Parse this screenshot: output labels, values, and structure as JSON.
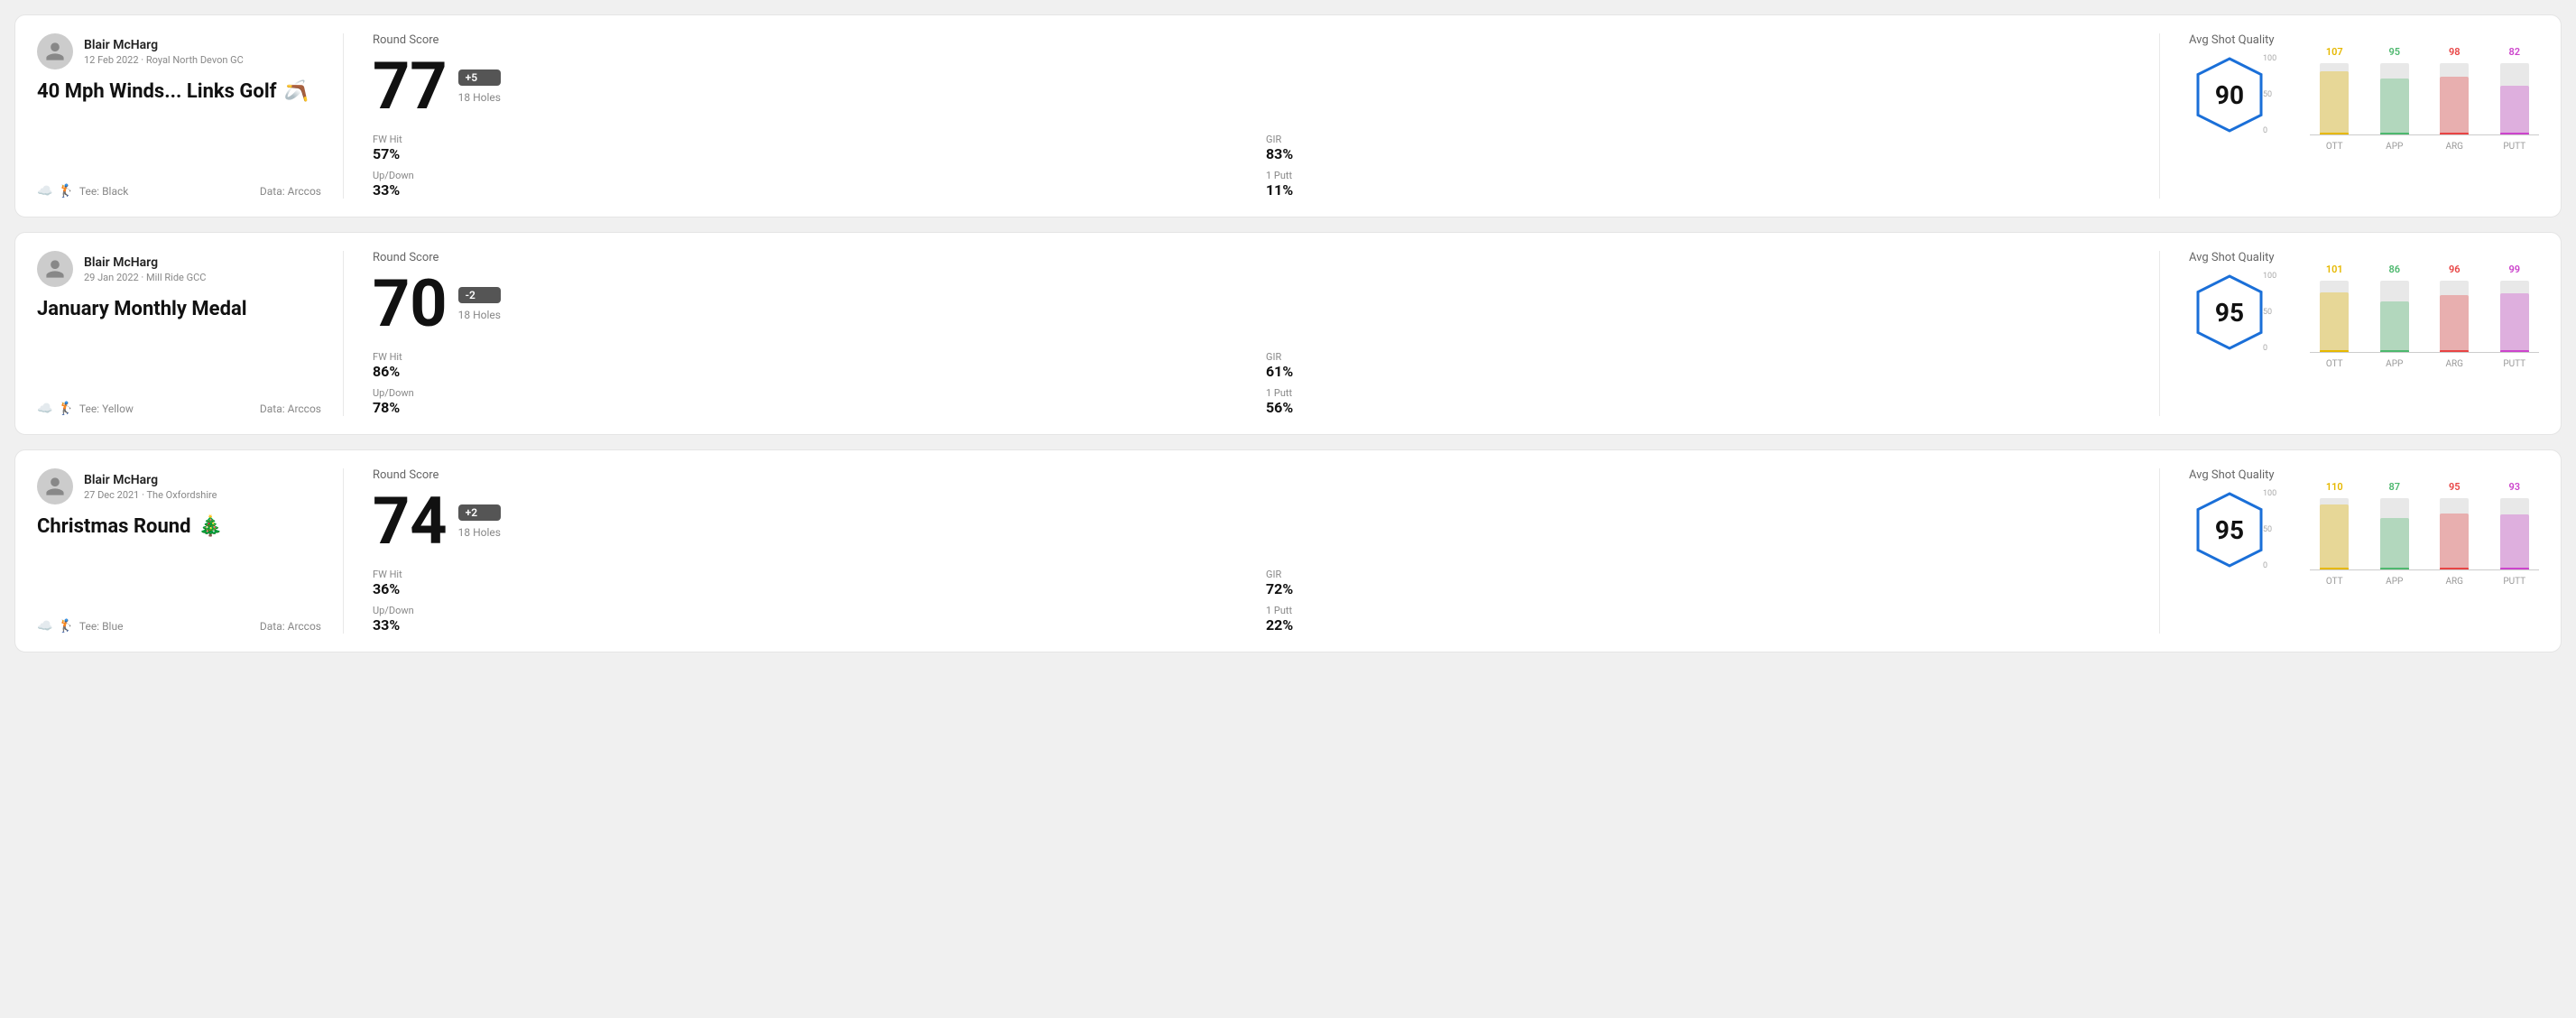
{
  "cards": [
    {
      "id": "round1",
      "player": {
        "name": "Blair McHarg",
        "date": "12 Feb 2022 · Royal North Devon GC"
      },
      "title": "40 Mph Winds... Links Golf",
      "emoji": "🪃",
      "tee": "Black",
      "dataSource": "Data: Arccos",
      "score": "77",
      "scoreDiff": "+5",
      "holes": "18 Holes",
      "fwHit": "57%",
      "gir": "83%",
      "upDown": "33%",
      "onePutt": "11%",
      "avgQuality": "90",
      "bars": [
        {
          "label": "OTT",
          "value": 107,
          "color": "#e6b800",
          "maxVal": 120
        },
        {
          "label": "APP",
          "value": 95,
          "color": "#4db86e",
          "maxVal": 120
        },
        {
          "label": "ARG",
          "value": 98,
          "color": "#e84444",
          "maxVal": 120
        },
        {
          "label": "PUTT",
          "value": 82,
          "color": "#cc44cc",
          "maxVal": 120
        }
      ]
    },
    {
      "id": "round2",
      "player": {
        "name": "Blair McHarg",
        "date": "29 Jan 2022 · Mill Ride GCC"
      },
      "title": "January Monthly Medal",
      "emoji": "",
      "tee": "Yellow",
      "dataSource": "Data: Arccos",
      "score": "70",
      "scoreDiff": "-2",
      "holes": "18 Holes",
      "fwHit": "86%",
      "gir": "61%",
      "upDown": "78%",
      "onePutt": "56%",
      "avgQuality": "95",
      "bars": [
        {
          "label": "OTT",
          "value": 101,
          "color": "#e6b800",
          "maxVal": 120
        },
        {
          "label": "APP",
          "value": 86,
          "color": "#4db86e",
          "maxVal": 120
        },
        {
          "label": "ARG",
          "value": 96,
          "color": "#e84444",
          "maxVal": 120
        },
        {
          "label": "PUTT",
          "value": 99,
          "color": "#cc44cc",
          "maxVal": 120
        }
      ]
    },
    {
      "id": "round3",
      "player": {
        "name": "Blair McHarg",
        "date": "27 Dec 2021 · The Oxfordshire"
      },
      "title": "Christmas Round",
      "emoji": "🎄",
      "tee": "Blue",
      "dataSource": "Data: Arccos",
      "score": "74",
      "scoreDiff": "+2",
      "holes": "18 Holes",
      "fwHit": "36%",
      "gir": "72%",
      "upDown": "33%",
      "onePutt": "22%",
      "avgQuality": "95",
      "bars": [
        {
          "label": "OTT",
          "value": 110,
          "color": "#e6b800",
          "maxVal": 120
        },
        {
          "label": "APP",
          "value": 87,
          "color": "#4db86e",
          "maxVal": 120
        },
        {
          "label": "ARG",
          "value": 95,
          "color": "#e84444",
          "maxVal": 120
        },
        {
          "label": "PUTT",
          "value": 93,
          "color": "#cc44cc",
          "maxVal": 120
        }
      ]
    }
  ],
  "labels": {
    "roundScore": "Round Score",
    "fwHit": "FW Hit",
    "gir": "GIR",
    "upDown": "Up/Down",
    "onePutt": "1 Putt",
    "avgShotQuality": "Avg Shot Quality",
    "yAxis100": "100",
    "yAxis50": "50",
    "yAxis0": "0"
  }
}
